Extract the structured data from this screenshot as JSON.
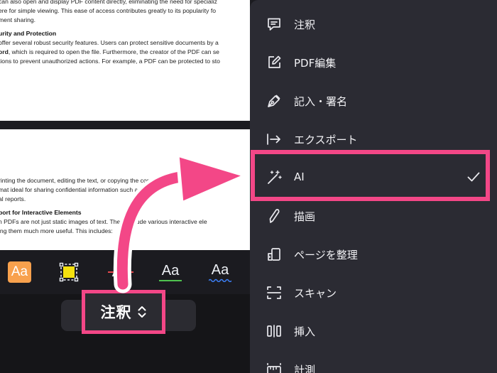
{
  "document": {
    "page1_lines": [
      "can also open and display PDF content directly, eliminating the need for specializ",
      "ere for simple viewing. This ease of access contributes greatly to its popularity fo",
      "ment sharing."
    ],
    "page1_heading": "urity and Protection",
    "page1_lines_b": [
      "offer several robust security features. Users can protect sensitive documents by a"
    ],
    "page1_bold_word": "ord",
    "page1_after_bold": ", which is required to open the file. Furthermore, the creator of the PDF can se",
    "page1_lines_c": [
      "tions to prevent unauthorized actions. For example, a PDF can be protected to sto"
    ],
    "page2_lines": [
      "rinting the document, editing the text, or copying the content. This",
      "mat ideal for sharing confidential information such as leg",
      "al reports."
    ],
    "page2_heading": "port for Interactive Elements",
    "page2_lines_b": [
      "n PDFs are not just static images of text. The   n include various interactive ele",
      "ing them much more useful. This includes:"
    ]
  },
  "toolbar": {
    "aa": "Aa",
    "tools": [
      "highlight-text",
      "area-highlight",
      "strikethrough",
      "underline",
      "squiggly-underline"
    ]
  },
  "mode_selector": {
    "label": "注釈"
  },
  "menu": {
    "items": [
      {
        "label": "注釈",
        "icon": "comment-icon"
      },
      {
        "label": "PDF編集",
        "icon": "edit-icon"
      },
      {
        "label": "記入・署名",
        "icon": "pen-icon"
      },
      {
        "label": "エクスポート",
        "icon": "export-icon"
      },
      {
        "label": "AI",
        "icon": "magic-wand-icon",
        "selected": true
      },
      {
        "label": "描画",
        "icon": "pencil-icon"
      },
      {
        "label": "ページを整理",
        "icon": "organize-pages-icon"
      },
      {
        "label": "スキャン",
        "icon": "scan-icon"
      },
      {
        "label": "挿入",
        "icon": "insert-icon"
      },
      {
        "label": "計測",
        "icon": "measure-icon"
      }
    ]
  },
  "colors": {
    "highlight_box": "#f34787",
    "menu_bg": "#2b2b33",
    "highlight_tool": "#f8a14d",
    "area_tool": "#f5e10f"
  }
}
